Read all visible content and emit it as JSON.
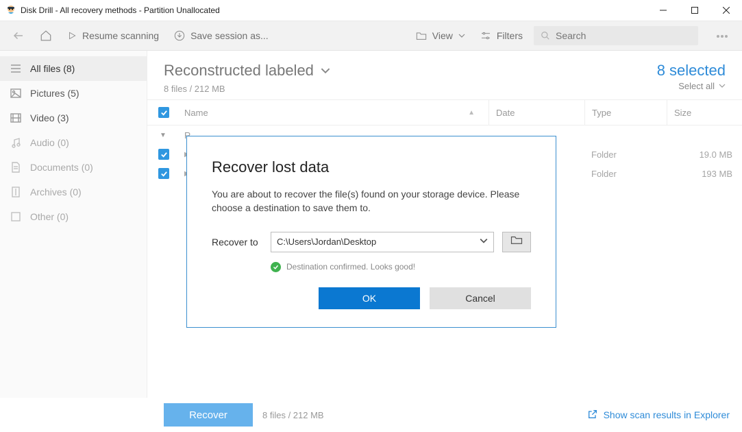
{
  "window": {
    "title": "Disk Drill - All recovery methods - Partition Unallocated"
  },
  "toolbar": {
    "resume": "Resume scanning",
    "save": "Save session as...",
    "view": "View",
    "filters": "Filters",
    "search_placeholder": "Search"
  },
  "sidebar": {
    "items": [
      {
        "label": "All files (8)"
      },
      {
        "label": "Pictures (5)"
      },
      {
        "label": "Video (3)"
      },
      {
        "label": "Audio (0)"
      },
      {
        "label": "Documents (0)"
      },
      {
        "label": "Archives (0)"
      },
      {
        "label": "Other (0)"
      }
    ]
  },
  "main": {
    "title": "Reconstructed labeled",
    "subtitle": "8 files / 212 MB",
    "selected": "8 selected",
    "select_all": "Select all",
    "columns": {
      "name": "Name",
      "date": "Date",
      "type": "Type",
      "size": "Size"
    },
    "rows": [
      {
        "name": "R",
        "type": "",
        "size": ""
      },
      {
        "name": "",
        "type": "Folder",
        "size": "19.0 MB"
      },
      {
        "name": "",
        "type": "Folder",
        "size": "193 MB"
      }
    ]
  },
  "footer": {
    "recover": "Recover",
    "summary": "8 files / 212 MB",
    "explorer": "Show scan results in Explorer"
  },
  "dialog": {
    "title": "Recover lost data",
    "text": "You are about to recover the file(s) found on your storage device. Please choose a destination to save them to.",
    "recover_to": "Recover to",
    "destination": "C:\\Users\\Jordan\\Desktop",
    "confirm": "Destination confirmed. Looks good!",
    "ok": "OK",
    "cancel": "Cancel"
  }
}
